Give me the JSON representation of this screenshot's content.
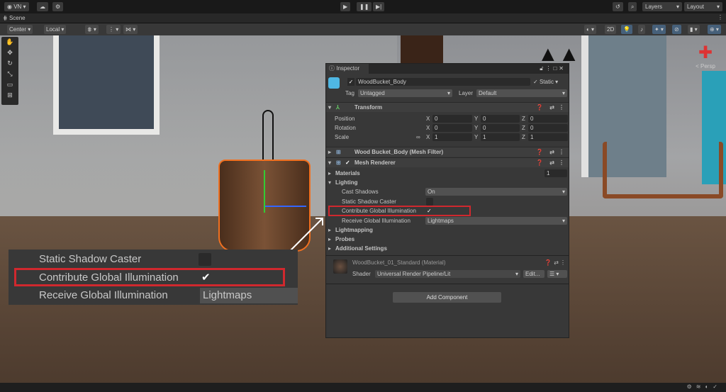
{
  "topbar": {
    "account": "VN",
    "layers": "Layers",
    "layout": "Layout"
  },
  "scene_tab": {
    "label": "Scene"
  },
  "scene_toolbar": {
    "pivot": "Center",
    "space": "Local",
    "mode_2d": "2D"
  },
  "scene": {
    "persp_label": "< Persp"
  },
  "inspector": {
    "tab": "Inspector",
    "object_name": "WoodBucket_Body",
    "static_label": "Static",
    "tag_label": "Tag",
    "tag_value": "Untagged",
    "layer_label": "Layer",
    "layer_value": "Default",
    "transform": {
      "title": "Transform",
      "rows": [
        {
          "label": "Position",
          "x": "0",
          "y": "0",
          "z": "0"
        },
        {
          "label": "Rotation",
          "x": "0",
          "y": "0",
          "z": "0"
        },
        {
          "label": "Scale",
          "x": "1",
          "y": "1",
          "z": "1"
        }
      ]
    },
    "mesh_filter": "Wood Bucket_Body (Mesh Filter)",
    "mesh_renderer": {
      "title": "Mesh Renderer",
      "materials_label": "Materials",
      "materials_count": "1",
      "lighting_label": "Lighting",
      "cast_shadows_label": "Cast Shadows",
      "cast_shadows_value": "On",
      "static_shadow_label": "Static Shadow Caster",
      "contribute_gi_label": "Contribute Global Illumination",
      "receive_gi_label": "Receive Global Illumination",
      "receive_gi_value": "Lightmaps",
      "lightmapping": "Lightmapping",
      "probes": "Probes",
      "additional": "Additional Settings"
    },
    "material": {
      "name": "WoodBucket_01_Standard (Material)",
      "shader_label": "Shader",
      "shader_value": "Universal Render Pipeline/Lit",
      "edit": "Edit..."
    },
    "add_component": "Add Component"
  },
  "callout": {
    "static_shadow": "Static Shadow Caster",
    "contribute_gi": "Contribute Global Illumination",
    "receive_gi": "Receive Global Illumination",
    "receive_value": "Lightmaps"
  },
  "colors": {
    "highlight": "#d0282e"
  }
}
